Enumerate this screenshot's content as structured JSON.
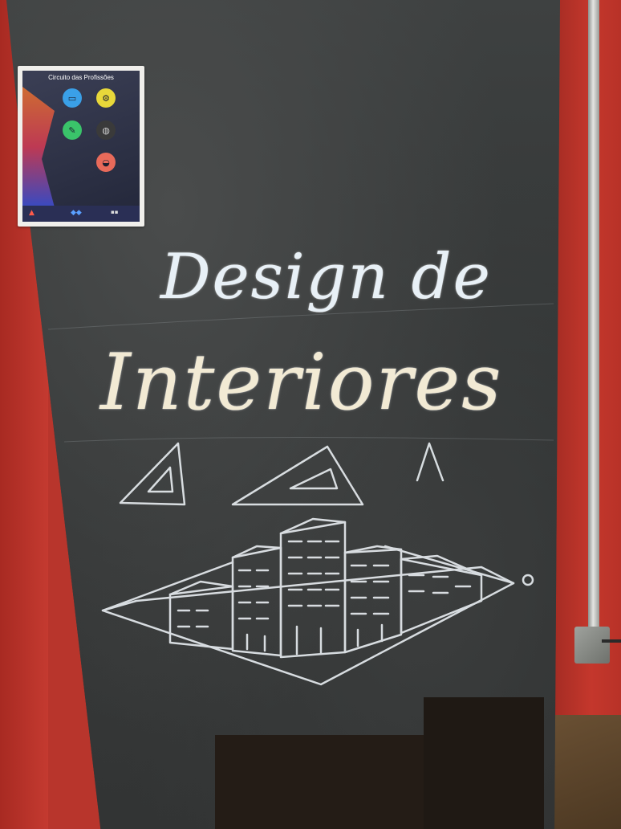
{
  "scene": {
    "wall_color": "#b8352c",
    "board_color": "#353838",
    "chalk_color": "#f2ead4"
  },
  "chalkboard": {
    "line1": "Design de",
    "line2": "Interiores"
  },
  "poster": {
    "title": "Circuito das Profissões",
    "info": "",
    "icons": [
      "computer-icon",
      "gear-icon",
      "pen-icon",
      "globe-icon",
      "helmet-icon"
    ]
  }
}
